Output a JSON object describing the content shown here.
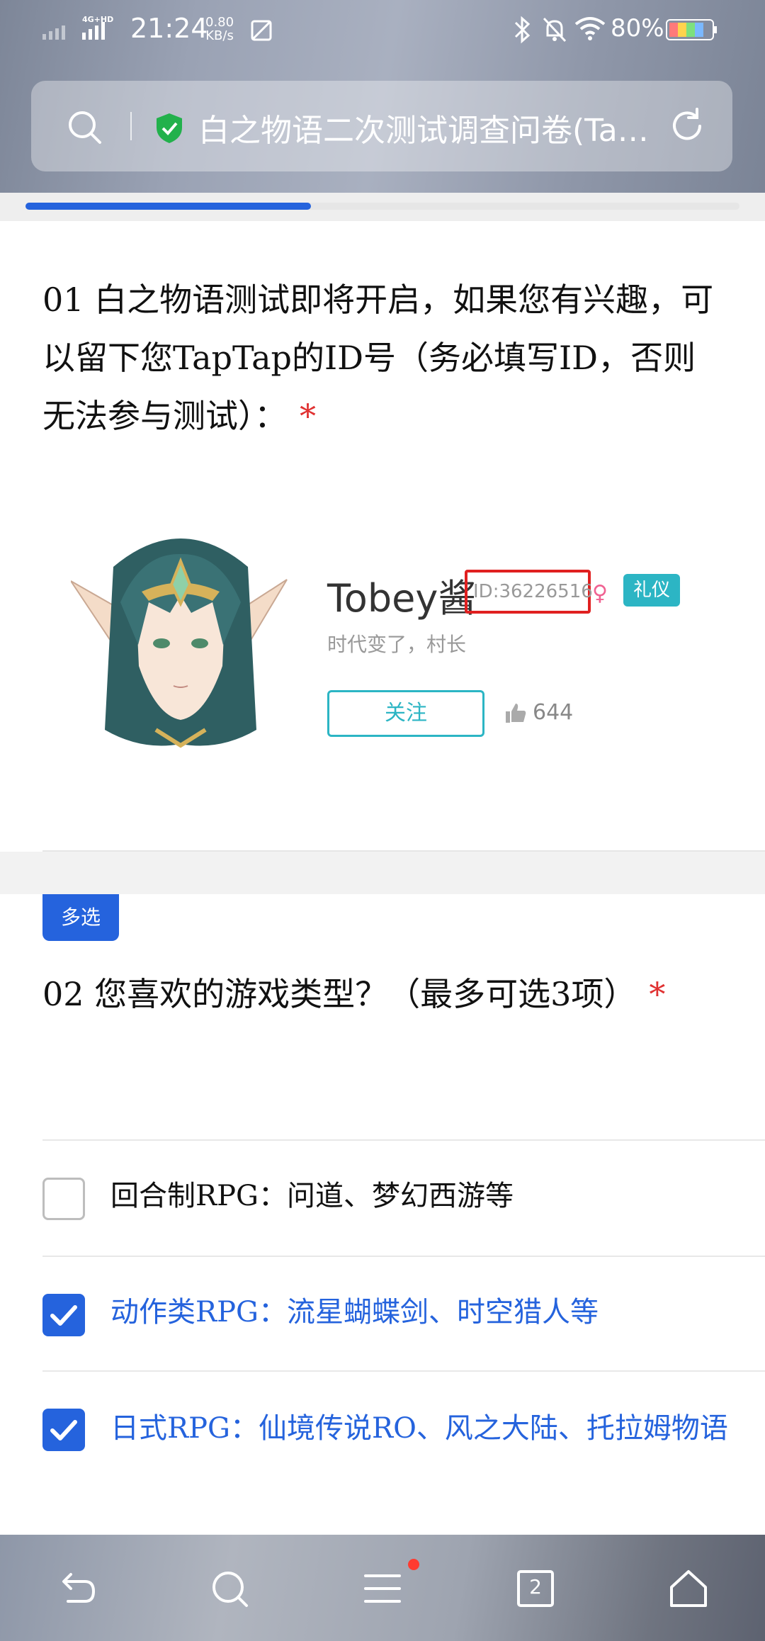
{
  "status_bar": {
    "network": "4G+HD",
    "time": "21:24",
    "speed_value": "0.80",
    "speed_unit": "KB/s",
    "battery": "80%"
  },
  "url_bar": {
    "title": "白之物语二次测试调查问卷(TapTap)",
    "icons": [
      "search-icon",
      "shield-check-icon",
      "reload-icon"
    ]
  },
  "page_progress": 0.4,
  "question1": {
    "text": "01 白之物语测试即将开启，如果您有兴趣，可以留下您TapTap的ID号（务必填写ID，否则无法参与测试）：",
    "required_mark": "*"
  },
  "profile_card": {
    "name": "Tobey酱",
    "id": "ID:36226516",
    "badge": "礼仪",
    "signature": "时代变了，村长",
    "follow_label": "关注",
    "likes": "644"
  },
  "question2": {
    "tag": "多选",
    "text": "02 您喜欢的游戏类型？（最多可选3项）",
    "required_mark": "*",
    "options": [
      {
        "label": "回合制RPG：问道、梦幻西游等",
        "checked": false
      },
      {
        "label": "动作类RPG：流星蝴蝶剑、时空猎人等",
        "checked": true
      },
      {
        "label": "日式RPG：仙境传说RO、风之大陆、托拉姆物语",
        "checked": true
      }
    ]
  },
  "bottom_nav": {
    "tabs_count": "2",
    "items": [
      "back-icon",
      "search-icon",
      "menu-icon",
      "tabs-icon",
      "home-icon"
    ]
  },
  "colors": {
    "accent": "#2563dd",
    "required": "#e03131",
    "taptap": "#2cb5c4"
  }
}
